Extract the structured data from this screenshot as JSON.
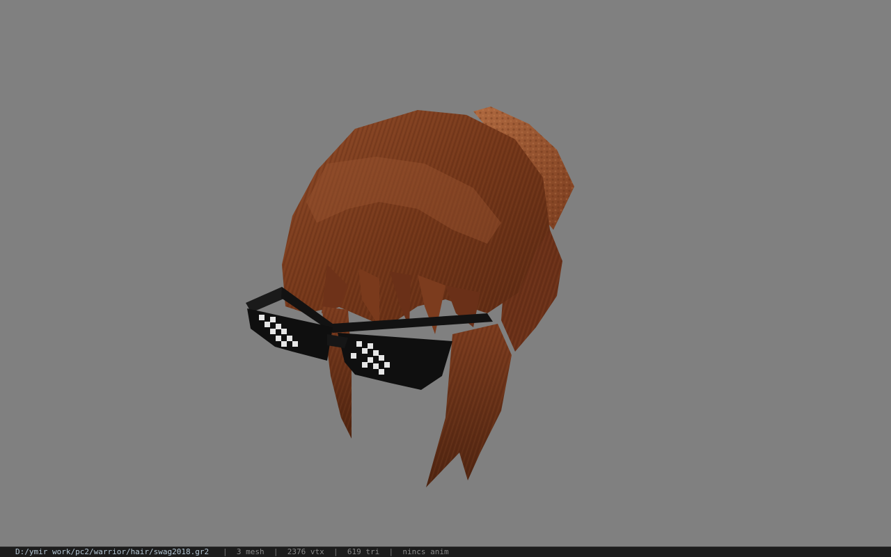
{
  "viewer": {
    "background": "#808080",
    "model_name": "hair-with-pixel-sunglasses"
  },
  "status": {
    "file_path": "D:/ymir work/pc2/warrior/hair/swag2018.gr2",
    "separator": "|",
    "mesh": "3 mesh",
    "vtx": "2376 vtx",
    "tri": "619 tri",
    "anim": "nincs anim"
  },
  "colors": {
    "hair_dark": "#5a2a16",
    "hair_mid": "#7a3e22",
    "hair_light": "#a05a34",
    "glasses": "#111111",
    "pixel_white": "#e8e8e8",
    "status_bg": "#1c1c1c",
    "status_text": "#8a8a8a",
    "path_text": "#b6c8d6"
  }
}
